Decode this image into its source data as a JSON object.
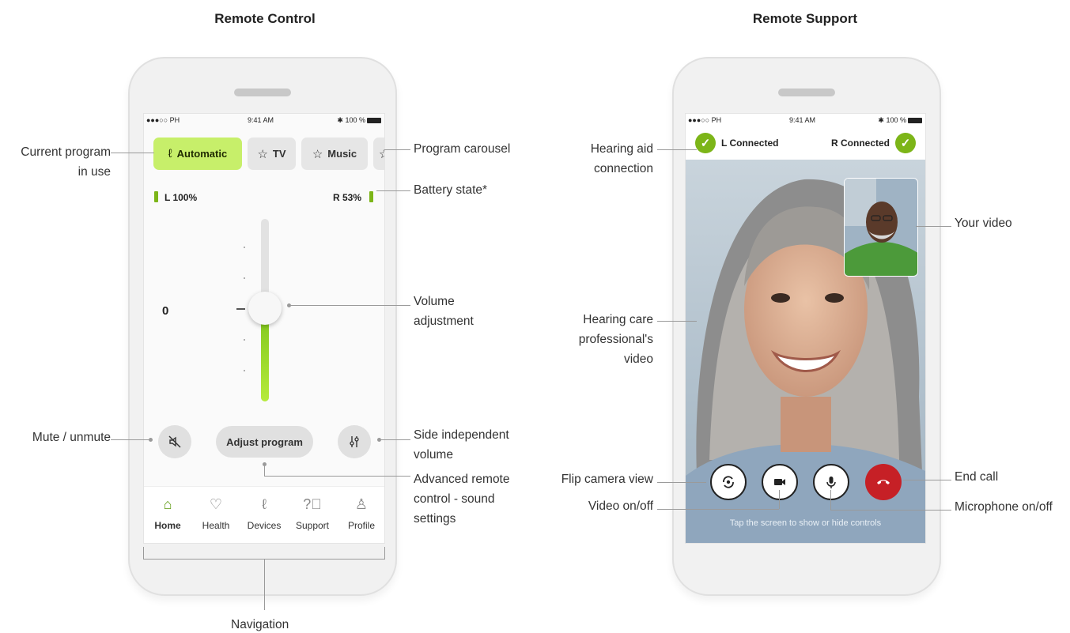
{
  "headings": {
    "left": "Remote Control",
    "right": "Remote Support"
  },
  "remote_control": {
    "status": {
      "carrier": "●●●○○ PH",
      "time": "9:41 AM",
      "battery": "100 %"
    },
    "programs": [
      {
        "label": "Automatic",
        "icon": "ear-icon",
        "active": true
      },
      {
        "label": "TV",
        "icon": "star-icon",
        "active": false
      },
      {
        "label": "Music",
        "icon": "star-icon",
        "active": false
      }
    ],
    "battery": {
      "left": "L 100%",
      "right": "R 53%",
      "left_level": 1.0,
      "right_level": 0.53
    },
    "volume": {
      "value": "0",
      "level": 0.5
    },
    "adjust_label": "Adjust program",
    "nav": [
      {
        "label": "Home",
        "icon": "home-icon",
        "active": true
      },
      {
        "label": "Health",
        "icon": "heart-icon",
        "active": false
      },
      {
        "label": "Devices",
        "icon": "hearing-aid-icon",
        "active": false
      },
      {
        "label": "Support",
        "icon": "question-icon",
        "active": false
      },
      {
        "label": "Profile",
        "icon": "person-icon",
        "active": false
      }
    ]
  },
  "remote_support": {
    "status": {
      "carrier": "●●●○○ PH",
      "time": "9:41 AM",
      "battery": "100 %"
    },
    "left_conn": "L Connected",
    "right_conn": "R Connected",
    "hint": "Tap the screen to show or hide controls",
    "colors": {
      "end_call": "#c62026",
      "accent": "#7cb518"
    }
  },
  "annotations": {
    "current_program": [
      "Current program",
      "in use"
    ],
    "program_carousel": "Program carousel",
    "battery_state": "Battery state*",
    "volume_adjustment": [
      "Volume",
      "adjustment"
    ],
    "mute": "Mute / unmute",
    "side_volume": [
      "Side independent",
      "volume"
    ],
    "advanced": [
      "Advanced remote",
      "control - sound",
      "settings"
    ],
    "navigation": "Navigation",
    "hearing_aid_connection": [
      "Hearing aid",
      "connection"
    ],
    "your_video": "Your video",
    "hcp_video": [
      "Hearing care",
      "professional's",
      "video"
    ],
    "flip_camera": "Flip camera view",
    "video_onoff": "Video on/off",
    "end_call": "End call",
    "mic_onoff": "Microphone on/off"
  }
}
